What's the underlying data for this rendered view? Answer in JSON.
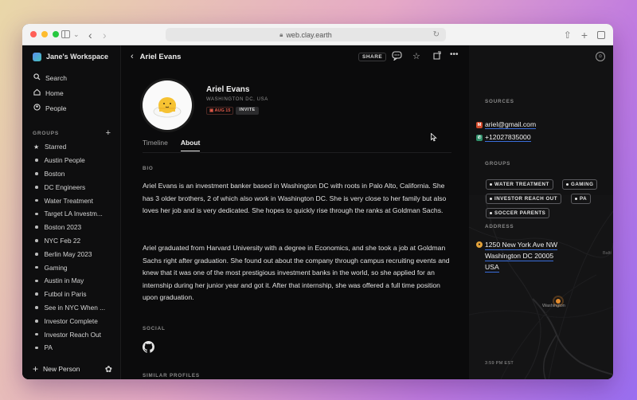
{
  "browser": {
    "url": "web.clay.earth",
    "colors": {
      "close": "#ff5f57",
      "minimize": "#febc2e",
      "zoom": "#28c840"
    }
  },
  "workspace": {
    "name": "Jane's Workspace"
  },
  "nav": [
    {
      "label": "Search",
      "icon": "search-icon"
    },
    {
      "label": "Home",
      "icon": "home-icon"
    },
    {
      "label": "People",
      "icon": "people-icon"
    }
  ],
  "groups": {
    "title": "GROUPS",
    "items": [
      "Starred",
      "Austin People",
      "Boston",
      "DC Engineers",
      "Water Treatment",
      "Target LA Investm...",
      "Boston 2023",
      "NYC Feb 22",
      "Berlin May 2023",
      "Gaming",
      "Austin in May",
      "Futbol in Paris",
      "See in NYC When ...",
      "Investor Complete",
      "Investor Reach Out",
      "PA"
    ]
  },
  "footer": {
    "new_person": "New Person"
  },
  "header": {
    "name": "Ariel Evans",
    "share": "SHARE"
  },
  "profile": {
    "name": "Ariel Evans",
    "location": "WASHINGTON DC, USA",
    "date_tag": "AUG 15",
    "invite_tag": "INVITE"
  },
  "tabs": [
    {
      "label": "Timeline",
      "active": false
    },
    {
      "label": "About",
      "active": true
    }
  ],
  "about": {
    "bio_label": "BIO",
    "bio_p1": "Ariel Evans is an investment banker based in Washington DC with roots in Palo Alto, California. She has 3 older brothers, 2 of which also work in Washington DC. She is very close to her family but also loves her job and is very dedicated. She hopes to quickly rise through the ranks at Goldman Sachs.",
    "bio_p2": "Ariel graduated from Harvard University with a degree in Economics, and she took a job at Goldman Sachs right after graduation. She found out about the company through campus recruiting events and knew that it was one of the most prestigious investment banks in the world, so she applied for an internship during her junior year and got it. After that internship, she was offered a full time position upon graduation.",
    "social_label": "SOCIAL",
    "similar_label": "SIMILAR PROFILES"
  },
  "right_panel": {
    "sources_label": "SOURCES",
    "email": "ariel@gmail.com",
    "phone": "+12027835000",
    "groups_label": "GROUPS",
    "group_chips": [
      "WATER TREATMENT",
      "GAMING",
      "INVESTOR REACH OUT",
      "PA",
      "SOCCER PARENTS"
    ],
    "address_label": "ADDRESS",
    "address_line1": "1250 New York Ave NW",
    "address_line2": "Washington DC 20005",
    "address_line3": "USA",
    "map_city": "Washington",
    "map_time": "3:59 PM EST",
    "map_edge_label": "Balti"
  }
}
